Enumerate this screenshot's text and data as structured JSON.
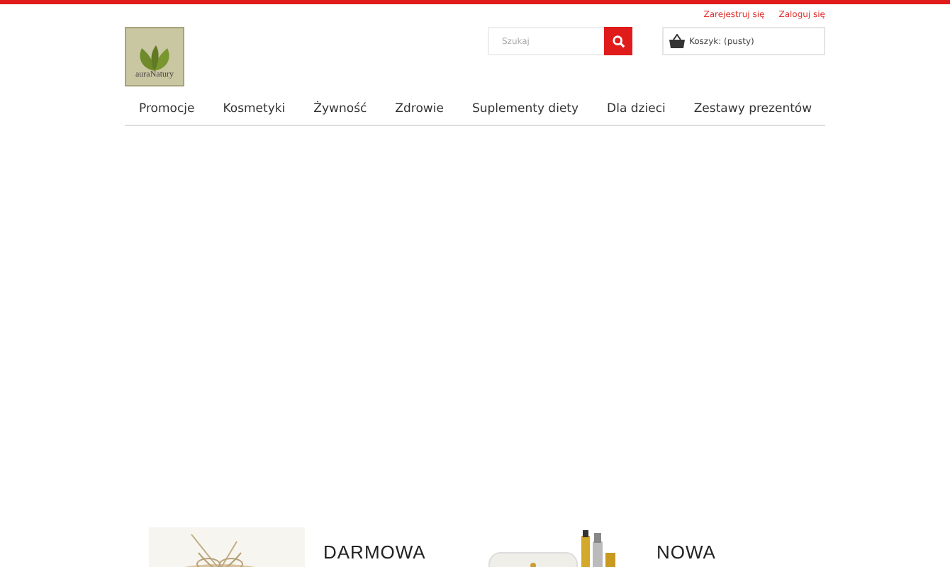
{
  "header_links": [
    "Zarejestruj się",
    "Zaloguj się"
  ],
  "logo": {
    "text": "auraNatury"
  },
  "search": {
    "placeholder": "Szukaj"
  },
  "cart": {
    "label": "Koszyk: (pusty)"
  },
  "nav": [
    "Promocje",
    "Kosmetyki",
    "Żywność",
    "Zdrowie",
    "Suplementy diety",
    "Dla dzieci",
    "Zestawy prezentów"
  ],
  "promos": [
    {
      "kind": "picture",
      "title": "DARMOWA"
    },
    {
      "kind": "picture",
      "title": "NOWA"
    }
  ]
}
